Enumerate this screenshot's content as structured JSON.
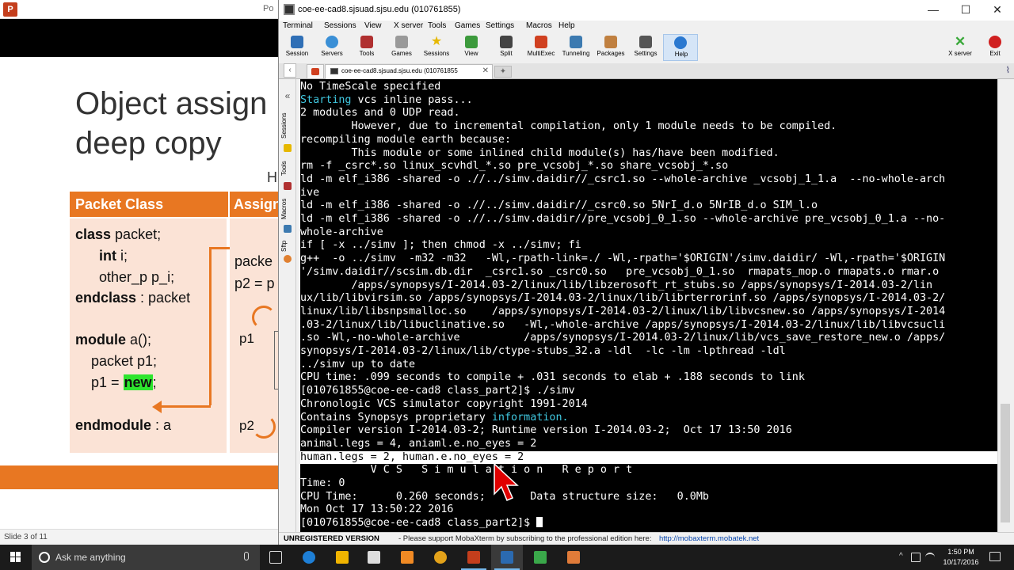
{
  "powerpoint": {
    "window_title_fragment": "Po",
    "slide_title_line1": "Object assign",
    "slide_title_line2": "deep copy",
    "subtitle_fragment": "H",
    "table_header_left": "Packet Class",
    "table_header_right": "Assign",
    "left_code": [
      {
        "kw": "class",
        "rest": " packet;"
      },
      {
        "kw": "int",
        "rest": " i;"
      },
      {
        "kw": "",
        "rest": "other_p  p_i;"
      },
      {
        "kw": "endclass",
        "rest": " : packet"
      },
      {
        "kw": "module",
        "rest": " a();"
      },
      {
        "kw": "",
        "rest": "packet p1;"
      },
      {
        "kw": "",
        "rest": "p1 = "
      },
      {
        "kw": "endmodule",
        "rest": " : a"
      }
    ],
    "new_keyword": "new",
    "new_semicolon": ";",
    "right_code": [
      "packe",
      "p2 = p",
      "p1",
      "p2"
    ],
    "status": "Slide 3 of 11"
  },
  "moba": {
    "title": "coe-ee-cad8.sjsuad.sjsu.edu (010761855)",
    "window_buttons": {
      "minimize": "—",
      "maximize": "☐",
      "close": "✕"
    },
    "menu": [
      "Terminal",
      "Sessions",
      "View",
      "X server",
      "Tools",
      "Games",
      "Settings",
      "Macros",
      "Help"
    ],
    "toolbar": [
      {
        "label": "Session",
        "icon": "session-icon",
        "color": "#2f6fb6"
      },
      {
        "label": "Servers",
        "icon": "servers-icon",
        "color": "#3a8fd6"
      },
      {
        "label": "Tools",
        "icon": "tools-icon",
        "color": "#b03030"
      },
      {
        "label": "Games",
        "icon": "games-icon",
        "color": "#999999"
      },
      {
        "label": "Sessions",
        "icon": "star-icon",
        "color": "#e6b800"
      },
      {
        "label": "View",
        "icon": "view-icon",
        "color": "#3c9a3c"
      },
      {
        "label": "Split",
        "icon": "split-icon",
        "color": "#444444"
      },
      {
        "label": "MultiExec",
        "icon": "multiexec-icon",
        "color": "#d04020"
      },
      {
        "label": "Tunneling",
        "icon": "tunneling-icon",
        "color": "#3c7ab0"
      },
      {
        "label": "Packages",
        "icon": "packages-icon",
        "color": "#c08040"
      },
      {
        "label": "Settings",
        "icon": "settings-icon",
        "color": "#555555"
      },
      {
        "label": "Help",
        "icon": "help-icon",
        "color": "#2a78d0"
      }
    ],
    "toolbar_right": [
      {
        "label": "X server",
        "icon": "x-server-icon",
        "color": "#39a839"
      },
      {
        "label": "Exit",
        "icon": "power-icon",
        "color": "#d02020"
      }
    ],
    "tab_label": "coe-ee-cad8.sjsuad.sjsu.edu (010761855",
    "tab_close": "✕",
    "side_tabs": [
      "Sessions",
      "Tools",
      "Macros",
      "Sftp"
    ],
    "terminal_lines": [
      {
        "t": "No TimeScale specified"
      },
      {
        "a": "",
        "c": "Starting",
        "b": " vcs inline pass..."
      },
      {
        "t": "2 modules and 0 UDP read."
      },
      {
        "t": "        However, due to incremental compilation, only 1 module needs to be compiled."
      },
      {
        "t": "recompiling module earth because:"
      },
      {
        "t": "        This module or some inlined child module(s) has/have been modified."
      },
      {
        "t": "rm -f _csrc*.so linux_scvhdl_*.so pre_vcsobj_*.so share_vcsobj_*.so"
      },
      {
        "t": "ld -m elf_i386 -shared -o .//../simv.daidir//_csrc1.so --whole-archive _vcsobj_1_1.a  --no-whole-arch"
      },
      {
        "t": "ive"
      },
      {
        "t": "ld -m elf_i386 -shared -o .//../simv.daidir//_csrc0.so 5NrI_d.o 5NrIB_d.o SIM_l.o"
      },
      {
        "t": "ld -m elf_i386 -shared -o .//../simv.daidir//pre_vcsobj_0_1.so --whole-archive pre_vcsobj_0_1.a --no-"
      },
      {
        "t": "whole-archive"
      },
      {
        "t": "if [ -x ../simv ]; then chmod -x ../simv; fi"
      },
      {
        "t": "g++  -o ../simv  -m32 -m32   -Wl,-rpath-link=./ -Wl,-rpath='$ORIGIN'/simv.daidir/ -Wl,-rpath='$ORIGIN"
      },
      {
        "t": "'/simv.daidir//scsim.db.dir  _csrc1.so _csrc0.so   pre_vcsobj_0_1.so  rmapats_mop.o rmapats.o rmar.o"
      },
      {
        "t": "        /apps/synopsys/I-2014.03-2/linux/lib/libzerosoft_rt_stubs.so /apps/synopsys/I-2014.03-2/lin"
      },
      {
        "t": "ux/lib/libvirsim.so /apps/synopsys/I-2014.03-2/linux/lib/librterrorinf.so /apps/synopsys/I-2014.03-2/"
      },
      {
        "t": "linux/lib/libsnpsmalloc.so    /apps/synopsys/I-2014.03-2/linux/lib/libvcsnew.so /apps/synopsys/I-2014"
      },
      {
        "t": ".03-2/linux/lib/libuclinative.so   -Wl,-whole-archive /apps/synopsys/I-2014.03-2/linux/lib/libvcsucli"
      },
      {
        "t": ".so -Wl,-no-whole-archive          /apps/synopsys/I-2014.03-2/linux/lib/vcs_save_restore_new.o /apps/"
      },
      {
        "t": "synopsys/I-2014.03-2/linux/lib/ctype-stubs_32.a -ldl  -lc -lm -lpthread -ldl"
      },
      {
        "t": "../simv up to date"
      },
      {
        "t": "CPU time: .099 seconds to compile + .031 seconds to elab + .188 seconds to link"
      },
      {
        "t": "[010761855@coe-ee-cad8 class_part2]$ ./simv"
      },
      {
        "t": "Chronologic VCS simulator copyright 1991-2014"
      },
      {
        "a": "Contains Synopsys proprietary ",
        "c": "information.",
        "b": ""
      },
      {
        "t": "Compiler version I-2014.03-2; Runtime version I-2014.03-2;  Oct 17 13:50 2016"
      },
      {
        "t": "animal.legs = 4, aniaml.e.no_eyes = 2"
      },
      {
        "t": "human.legs = 2, human.e.no_eyes = 2",
        "sel": true
      },
      {
        "t": "           V C S   S i m u l a t i o n   R e p o r t"
      },
      {
        "t": "Time: 0"
      },
      {
        "t": "CPU Time:      0.260 seconds;       Data structure size:   0.0Mb"
      },
      {
        "t": "Mon Oct 17 13:50:22 2016"
      },
      {
        "t": "[010761855@coe-ee-cad8 class_part2]$ ",
        "cursor": true
      }
    ],
    "status_unregistered": "UNREGISTERED VERSION",
    "status_support": "-  Please support MobaXterm by subscribing to the professional edition here:",
    "status_link": "http://mobaxterm.mobatek.net"
  },
  "taskbar": {
    "search_placeholder": "Ask me anything",
    "apps": [
      {
        "icon": "task-view-icon",
        "color": "#dddddd"
      },
      {
        "icon": "edge-icon",
        "color": "#1e7fd6"
      },
      {
        "icon": "store-icon",
        "color": "#dddddd"
      },
      {
        "icon": "file-explorer-icon",
        "color": "#f0b400"
      },
      {
        "icon": "orange-app-icon",
        "color": "#f08a24"
      },
      {
        "icon": "chrome-icon",
        "color": "#e3a21a"
      },
      {
        "icon": "powerpoint-icon",
        "color": "#c43e1c"
      },
      {
        "icon": "mobaxterm-icon",
        "color": "#2b6ab0"
      },
      {
        "icon": "green-x-icon",
        "color": "#3aa84a"
      },
      {
        "icon": "paint-icon",
        "color": "#e07b39"
      }
    ],
    "time": "1:50 PM",
    "date": "10/17/2016"
  }
}
